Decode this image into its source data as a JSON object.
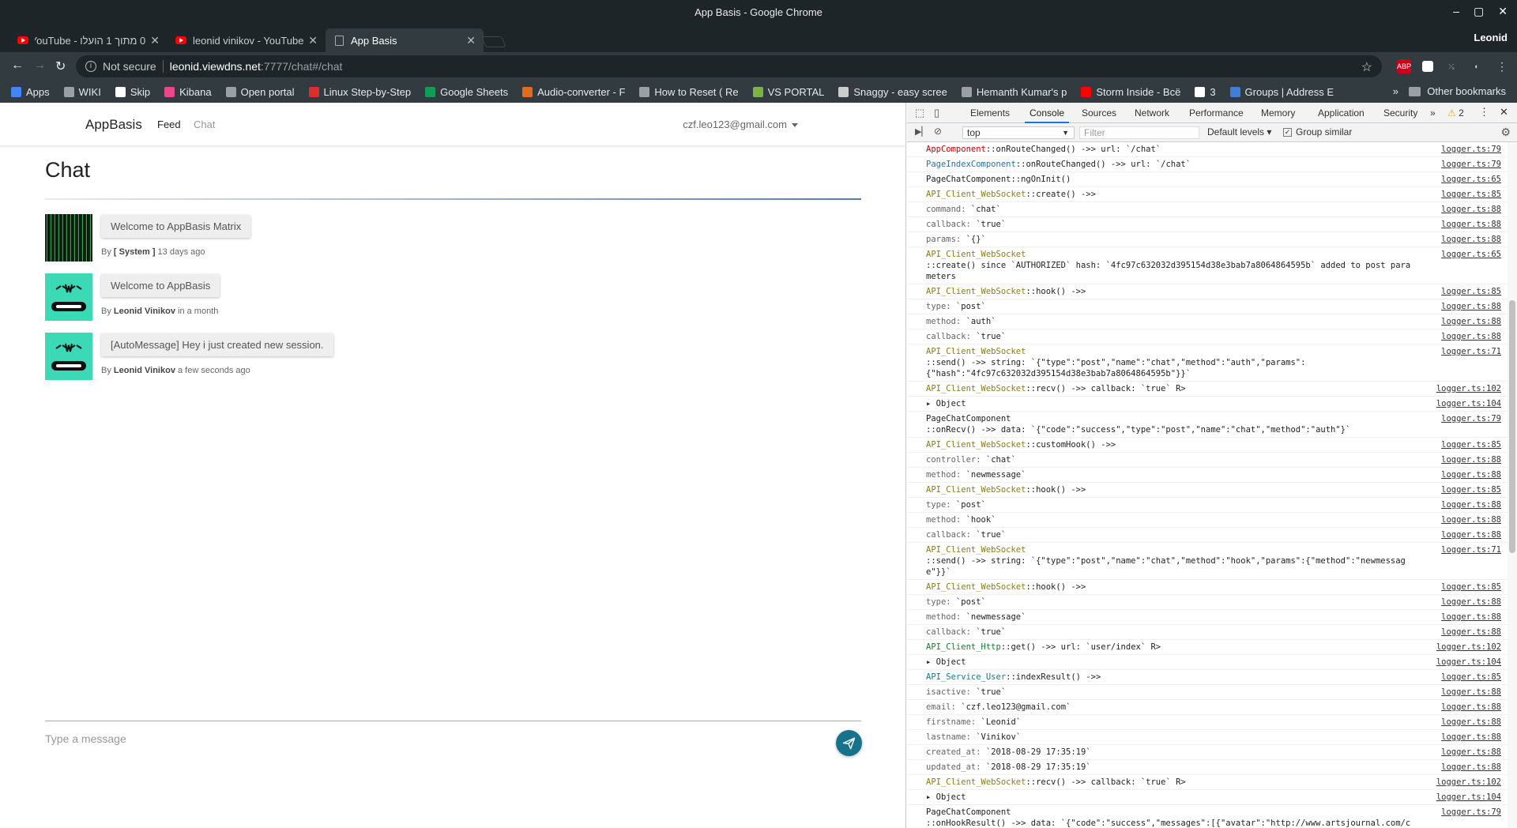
{
  "window": {
    "title": "App Basis - Google Chrome",
    "controls": [
      "–",
      "▢",
      "✕"
    ],
    "profile": "Leonid"
  },
  "tabs": [
    {
      "label": "0 מתוך 1 הועלו - YouTube",
      "favicon": "youtube-icon"
    },
    {
      "label": "leonid vinikov - YouTube",
      "favicon": "youtube-icon"
    },
    {
      "label": "App Basis",
      "favicon": "document-icon"
    }
  ],
  "omnibar": {
    "not_secure": "Not secure",
    "host": "leonid.viewdns.net",
    "path": ":7777/chat#/chat"
  },
  "bookmarks": [
    {
      "label": "Apps",
      "color": "#4285f4"
    },
    {
      "label": "WIKI",
      "color": "#9aa0a6"
    },
    {
      "label": "Skip",
      "color": "#ffffff"
    },
    {
      "label": "Kibana",
      "color": "#e8488b"
    },
    {
      "label": "Open portal",
      "color": "#9aa0a6"
    },
    {
      "label": "Linux Step-by-Step",
      "color": "#d9302c"
    },
    {
      "label": "Google Sheets",
      "color": "#0f9d58"
    },
    {
      "label": "Audio-converter - F",
      "color": "#e06c1f"
    },
    {
      "label": "How to Reset ( Re",
      "color": "#9aa0a6"
    },
    {
      "label": "VS PORTAL",
      "color": "#7cb342"
    },
    {
      "label": "Snaggy - easy scree",
      "color": "#cccccc"
    },
    {
      "label": "Hemanth Kumar's p",
      "color": "#9aa0a6"
    },
    {
      "label": "Storm Inside - Всё",
      "color": "#ff0000"
    },
    {
      "label": "3",
      "color": "#ffffff"
    },
    {
      "label": "Groups | Address E",
      "color": "#3f7fd6"
    }
  ],
  "bookmarks_more": "»",
  "other_bookmarks": "Other bookmarks",
  "app": {
    "brand": "AppBasis",
    "nav_feed": "Feed",
    "nav_chat": "Chat",
    "user_email": "czf.leo123@gmail.com",
    "page_title": "Chat",
    "messages": [
      {
        "text": "Welcome to AppBasis Matrix",
        "by": "By",
        "author": "[ System ]",
        "when": "13 days ago"
      },
      {
        "text": "Welcome to AppBasis",
        "by": "By",
        "author": "Leonid Vinikov",
        "when": "in a month"
      },
      {
        "text": "[AutoMessage] Hey i just created new session.",
        "by": "By",
        "author": "Leonid Vinikov",
        "when": "a few seconds ago"
      }
    ],
    "input_placeholder": "Type a message"
  },
  "devtools": {
    "tabs": [
      "Elements",
      "Console",
      "Sources",
      "Network",
      "Performance",
      "Memory",
      "Application",
      "Security"
    ],
    "more": "»",
    "warnings": "2",
    "context": "top",
    "filter_placeholder": "Filter",
    "levels": "Default levels ▾",
    "group_similar": "Group similar",
    "log": [
      {
        "cls": "c-red",
        "text": "AppComponent",
        "rest": "::onRouteChanged() ->> url: `/chat`",
        "src": "logger.ts:79"
      },
      {
        "cls": "c-blue",
        "text": "PageIndexComponent",
        "rest": "::onRouteChanged() ->> url: `/chat`",
        "src": "logger.ts:79"
      },
      {
        "cls": "c-black",
        "text": "PageChatComponent",
        "rest": "::ngOnInit()",
        "src": "logger.ts:65"
      },
      {
        "cls": "c-olive",
        "text": "API_Client_WebSocket",
        "rest": "::create() ->>",
        "src": "logger.ts:85"
      },
      {
        "cls": "c-gray",
        "text": "command:",
        "rest": " `chat`",
        "src": "logger.ts:88"
      },
      {
        "cls": "c-gray",
        "text": "callback:",
        "rest": " `true`",
        "src": "logger.ts:88"
      },
      {
        "cls": "c-gray",
        "text": "params:",
        "rest": " `{}`",
        "src": "logger.ts:88"
      },
      {
        "cls": "c-olive",
        "text": "API_Client_WebSocket",
        "rest": "\n::create() since `AUTHORIZED` hash: `4fc97c632032d395154d38e3bab7a8064864595b` added to post parameters",
        "src": "logger.ts:65"
      },
      {
        "cls": "c-olive",
        "text": "API_Client_WebSocket",
        "rest": "::hook() ->>",
        "src": "logger.ts:85"
      },
      {
        "cls": "c-gray",
        "text": "type:",
        "rest": " `post`",
        "src": "logger.ts:88"
      },
      {
        "cls": "c-gray",
        "text": "method:",
        "rest": " `auth`",
        "src": "logger.ts:88"
      },
      {
        "cls": "c-gray",
        "text": "callback:",
        "rest": " `true`",
        "src": "logger.ts:88"
      },
      {
        "cls": "c-olive",
        "text": "API_Client_WebSocket",
        "rest": "\n::send() ->> string: `{\"type\":\"post\",\"name\":\"chat\",\"method\":\"auth\",\"params\":\n{\"hash\":\"4fc97c632032d395154d38e3bab7a8064864595b\"}}`",
        "src": "logger.ts:71"
      },
      {
        "cls": "c-olive",
        "text": "API_Client_WebSocket",
        "rest": "::recv() ->> callback: `true` R>",
        "src": "logger.ts:102"
      },
      {
        "cls": "c-black",
        "text": "▸ Object",
        "rest": "",
        "src": "logger.ts:104"
      },
      {
        "cls": "c-black",
        "text": "PageChatComponent",
        "rest": "\n::onRecv() ->> data: `{\"code\":\"success\",\"type\":\"post\",\"name\":\"chat\",\"method\":\"auth\"}`",
        "src": "logger.ts:79"
      },
      {
        "cls": "c-olive",
        "text": "API_Client_WebSocket",
        "rest": "::customHook() ->>",
        "src": "logger.ts:85"
      },
      {
        "cls": "c-gray",
        "text": "controller:",
        "rest": " `chat`",
        "src": "logger.ts:88"
      },
      {
        "cls": "c-gray",
        "text": "method:",
        "rest": " `newmessage`",
        "src": "logger.ts:88"
      },
      {
        "cls": "c-olive",
        "text": "API_Client_WebSocket",
        "rest": "::hook() ->>",
        "src": "logger.ts:85"
      },
      {
        "cls": "c-gray",
        "text": "type:",
        "rest": " `post`",
        "src": "logger.ts:88"
      },
      {
        "cls": "c-gray",
        "text": "method:",
        "rest": " `hook`",
        "src": "logger.ts:88"
      },
      {
        "cls": "c-gray",
        "text": "callback:",
        "rest": " `true`",
        "src": "logger.ts:88"
      },
      {
        "cls": "c-olive",
        "text": "API_Client_WebSocket",
        "rest": "\n::send() ->> string: `{\"type\":\"post\",\"name\":\"chat\",\"method\":\"hook\",\"params\":{\"method\":\"newmessage\"}}`",
        "src": "logger.ts:71"
      },
      {
        "cls": "c-olive",
        "text": "API_Client_WebSocket",
        "rest": "::hook() ->>",
        "src": "logger.ts:85"
      },
      {
        "cls": "c-gray",
        "text": "type:",
        "rest": " `post`",
        "src": "logger.ts:88"
      },
      {
        "cls": "c-gray",
        "text": "method:",
        "rest": " `newmessage`",
        "src": "logger.ts:88"
      },
      {
        "cls": "c-gray",
        "text": "callback:",
        "rest": " `true`",
        "src": "logger.ts:88"
      },
      {
        "cls": "c-green",
        "text": "API_Client_Http",
        "rest": "::get() ->> url: `user/index` R>",
        "src": "logger.ts:102"
      },
      {
        "cls": "c-black",
        "text": "▸ Object",
        "rest": "",
        "src": "logger.ts:104"
      },
      {
        "cls": "c-teal",
        "text": "API_Service_User",
        "rest": "::indexResult() ->>",
        "src": "logger.ts:85"
      },
      {
        "cls": "c-gray",
        "text": "isactive:",
        "rest": " `true`",
        "src": "logger.ts:88"
      },
      {
        "cls": "c-gray",
        "text": "email:",
        "rest": " `czf.leo123@gmail.com`",
        "src": "logger.ts:88"
      },
      {
        "cls": "c-gray",
        "text": "firstname:",
        "rest": " `Leonid`",
        "src": "logger.ts:88"
      },
      {
        "cls": "c-gray",
        "text": "lastname:",
        "rest": " `Vinikov`",
        "src": "logger.ts:88"
      },
      {
        "cls": "c-gray",
        "text": "created_at:",
        "rest": " `2018-08-29 17:35:19`",
        "src": "logger.ts:88"
      },
      {
        "cls": "c-gray",
        "text": "updated_at:",
        "rest": " `2018-08-29 17:35:19`",
        "src": "logger.ts:88"
      },
      {
        "cls": "c-olive",
        "text": "API_Client_WebSocket",
        "rest": "::recv() ->> callback: `true` R>",
        "src": "logger.ts:102"
      },
      {
        "cls": "c-black",
        "text": "▸ Object",
        "rest": "",
        "src": "logger.ts:104"
      },
      {
        "cls": "c-black",
        "text": "PageChatComponent",
        "rest": "\n::onHookResult() ->> data: `{\"code\":\"success\",\"messages\":[{\"avatar\":\"http://www.artsjournal.com/curves/wp-content/uploads/2018/05/matrix-3109378_1280-200x200.jpg\",\"date\":\"2018-09-25 23:00:00\",\"message\":\"Welcome to AppBasis Matrix\",\"owner\":\"[ System ]\"},{\"avatar\":\"https://api.adorable.io/avatars/200/1\",\"date\":\"2018-11-5",
        "src": "logger.ts:79"
      }
    ]
  }
}
